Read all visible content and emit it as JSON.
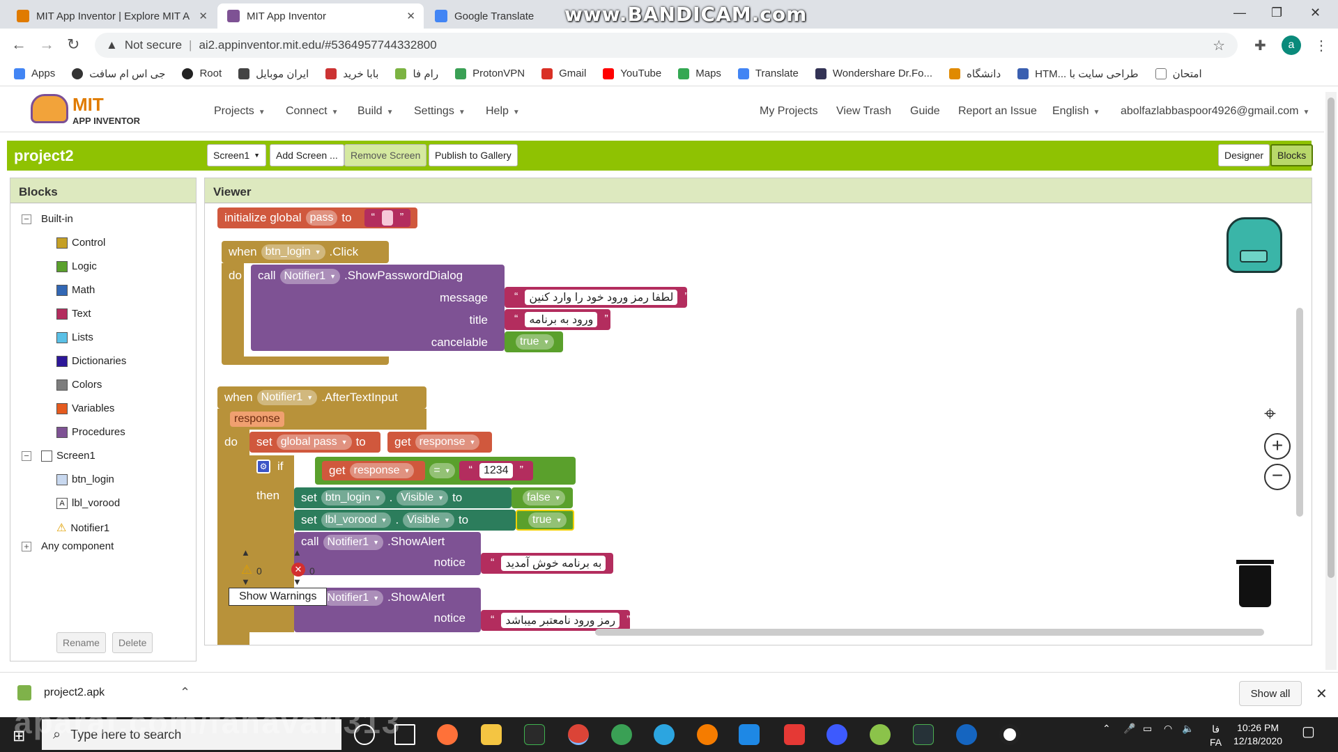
{
  "browser": {
    "tabs": [
      {
        "label": "MIT App Inventor | Explore MIT A",
        "active": false
      },
      {
        "label": "MIT App Inventor",
        "active": true
      },
      {
        "label": "Google Translate",
        "active": false
      }
    ],
    "watermark_top": "www.BANDICAM.com",
    "url_warning": "Not secure",
    "url": "ai2.appinventor.mit.edu/#5364957744332800",
    "profile_initial": "a",
    "bookmarks": [
      "Apps",
      "جی اس ام سافت",
      "Root",
      "ایران موبایل",
      "بابا خرید",
      "رام فا",
      "ProtonVPN",
      "Gmail",
      "YouTube",
      "Maps",
      "Translate",
      "Wondershare Dr.Fo...",
      "دانشگاه",
      "HTM... طراحی سایت با",
      "امتحان"
    ]
  },
  "ai": {
    "logo_mit": "MIT",
    "logo_sub": "APP INVENTOR",
    "menus": [
      "Projects",
      "Connect",
      "Build",
      "Settings",
      "Help"
    ],
    "right_links": [
      "My Projects",
      "View Trash",
      "Guide",
      "Report an Issue"
    ],
    "language": "English",
    "account": "abolfazlabbaspoor4926@gmail.com"
  },
  "project": {
    "name": "project2",
    "screen_select": "Screen1",
    "add_screen": "Add Screen ...",
    "remove_screen": "Remove Screen",
    "publish": "Publish to Gallery",
    "designer": "Designer",
    "blocks": "Blocks"
  },
  "blocks_panel": {
    "title": "Blocks",
    "builtin_label": "Built-in",
    "builtin": [
      {
        "label": "Control",
        "color": "#c5a026"
      },
      {
        "label": "Logic",
        "color": "#5aa02c"
      },
      {
        "label": "Math",
        "color": "#3267b4"
      },
      {
        "label": "Text",
        "color": "#b32d5e"
      },
      {
        "label": "Lists",
        "color": "#5ac0e6"
      },
      {
        "label": "Dictionaries",
        "color": "#2d1799"
      },
      {
        "label": "Colors",
        "color": "#7d7d7d"
      },
      {
        "label": "Variables",
        "color": "#e55b1f"
      },
      {
        "label": "Procedures",
        "color": "#7e5294"
      }
    ],
    "screen_label": "Screen1",
    "components": [
      "btn_login",
      "lbl_vorood",
      "Notifier1"
    ],
    "any_component": "Any component",
    "rename": "Rename",
    "delete": "Delete"
  },
  "viewer": {
    "title": "Viewer",
    "global_init": {
      "kw1": "initialize global",
      "name": "pass",
      "kw2": "to"
    },
    "event1": {
      "when": "when",
      "component": "btn_login",
      "event": ".Click",
      "do": "do",
      "call": "call",
      "callee": "Notifier1",
      "method": ".ShowPasswordDialog",
      "message_label": "message",
      "message": "لطفا رمز ورود خود را وارد کنین",
      "title_label": "title",
      "title": "ورود به برنامه",
      "cancelable_label": "cancelable",
      "cancelable": "true"
    },
    "event2": {
      "when": "when",
      "component": "Notifier1",
      "event": ".AfterTextInput",
      "param": "response",
      "do": "do",
      "set": "set",
      "set_var": "global pass",
      "to": "to",
      "get": "get",
      "get_var": "response",
      "if": "if",
      "then": "then",
      "op": "=",
      "compare_value": "1234",
      "set1_comp": "btn_login",
      "set1_prop": "Visible",
      "set1_val": "false",
      "set2_comp": "lbl_vorood",
      "set2_prop": "Visible",
      "set2_val": "true",
      "alert1_method": ".ShowAlert",
      "notice_label": "notice",
      "alert1_text": "به برنامه خوش آمدید",
      "alert2_method": ".ShowAlert",
      "alert2_text": "رمز ورود نامعتبر میباشد"
    },
    "warnings_count": "0",
    "errors_count": "0",
    "show_warnings": "Show Warnings"
  },
  "downloads": {
    "file": "project2.apk",
    "show_all": "Show all"
  },
  "taskbar": {
    "search_placeholder": "Type here to search",
    "time": "10:26 PM",
    "date": "12/18/2020",
    "lang": "FA",
    "lang_top": "فا"
  },
  "watermark_bottom": "aparat.com/fanavari313"
}
